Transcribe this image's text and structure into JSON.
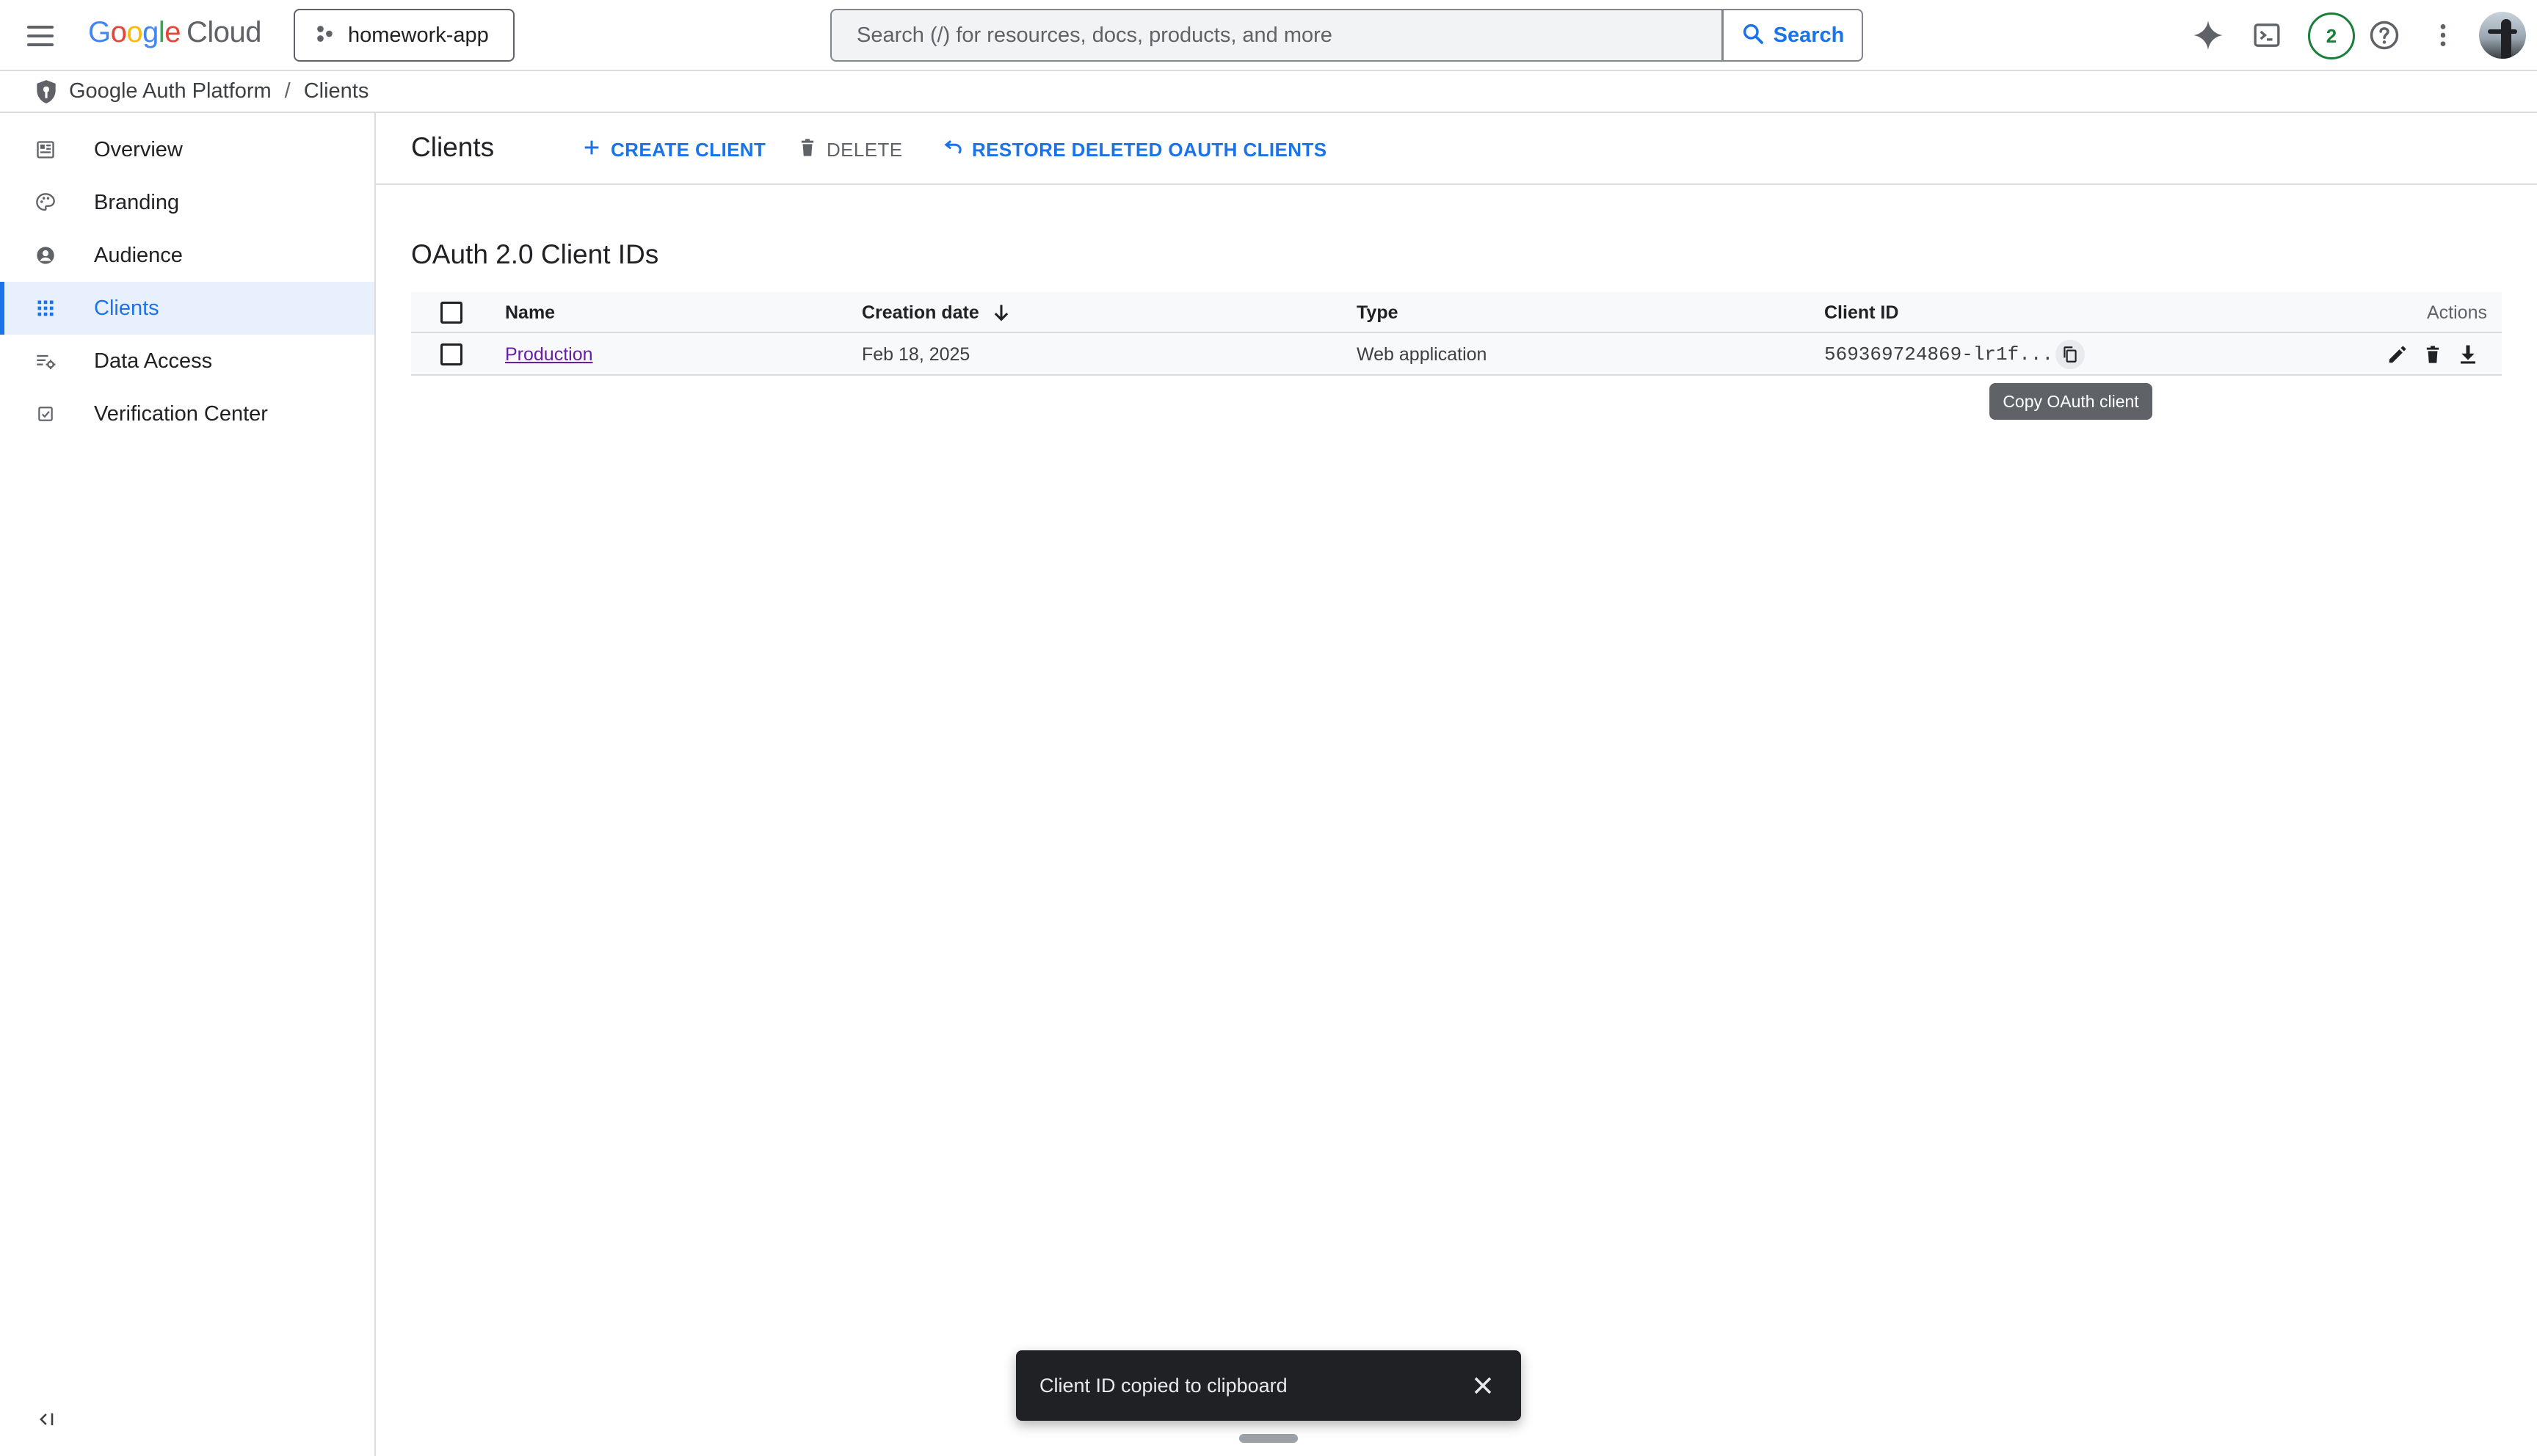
{
  "header": {
    "logo_parts": [
      "G",
      "o",
      "o",
      "g",
      "l",
      "e"
    ],
    "logo_product": "Cloud",
    "project": "homework-app",
    "search_placeholder": "Search (/) for resources, docs, products, and more",
    "search_button": "Search",
    "notifications_count": "2",
    "icons": [
      "menu-icon",
      "project-icon",
      "search-icon",
      "gemini-sparkle-icon",
      "cloud-shell-icon",
      "help-icon",
      "more-vert-icon"
    ]
  },
  "breadcrumb": {
    "items": [
      "Google Auth Platform",
      "Clients"
    ],
    "separator": "/"
  },
  "sidebar": {
    "items": [
      {
        "label": "Overview",
        "icon": "dashboard-icon",
        "active": false
      },
      {
        "label": "Branding",
        "icon": "palette-icon",
        "active": false
      },
      {
        "label": "Audience",
        "icon": "account-circle-icon",
        "active": false
      },
      {
        "label": "Clients",
        "icon": "apps-grid-icon",
        "active": true
      },
      {
        "label": "Data Access",
        "icon": "data-settings-icon",
        "active": false
      },
      {
        "label": "Verification Center",
        "icon": "checklist-icon",
        "active": false
      }
    ],
    "collapse_icon": "collapse-left-icon"
  },
  "toolbar": {
    "title": "Clients",
    "create_label": "CREATE CLIENT",
    "delete_label": "DELETE",
    "restore_label": "RESTORE DELETED OAUTH CLIENTS"
  },
  "section": {
    "title": "OAuth 2.0 Client IDs"
  },
  "table": {
    "columns": [
      "Name",
      "Creation date",
      "Type",
      "Client ID",
      "Actions"
    ],
    "sort_column": "Creation date",
    "sort_direction": "descending",
    "rows": [
      {
        "name": "Production",
        "creation_date": "Feb 18, 2025",
        "type": "Web application",
        "client_id": "569369724869-lr1f..."
      }
    ],
    "row_action_icons": [
      "copy-icon",
      "edit-icon",
      "delete-icon",
      "download-icon"
    ]
  },
  "tooltip": "Copy OAuth client",
  "snackbar": {
    "message": "Client ID copied to clipboard"
  },
  "colors": {
    "accent": "#1a73e8",
    "link_visited": "#681da8",
    "active_nav_bg": "#e8f0fe",
    "snackbar_bg": "#202124",
    "tooltip_bg": "#5f6368",
    "notif_green": "#188038"
  }
}
